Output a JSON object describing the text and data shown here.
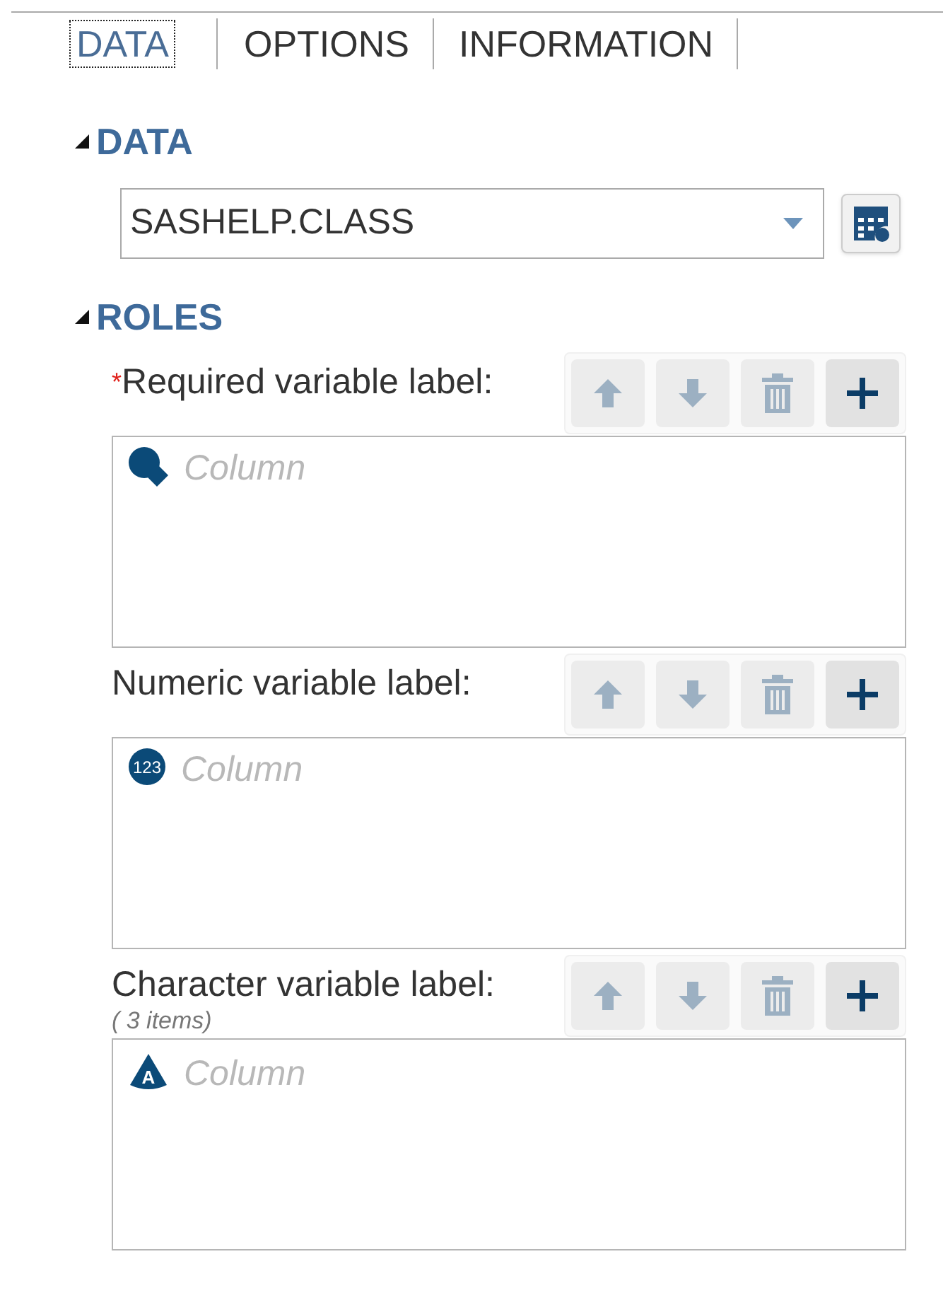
{
  "tabs": [
    {
      "label": "DATA",
      "selected": true
    },
    {
      "label": "OPTIONS",
      "selected": false
    },
    {
      "label": "INFORMATION",
      "selected": false
    }
  ],
  "data_section": {
    "title": "DATA",
    "expanded": true,
    "dataset": "SASHELP.CLASS"
  },
  "roles_section": {
    "title": "ROLES",
    "expanded": true,
    "roles": [
      {
        "label": "Required variable label:",
        "required": true,
        "required_mark": "*",
        "kind": "any",
        "placeholder": "Column",
        "buttons": [
          {
            "kind": "up",
            "disabled": true
          },
          {
            "kind": "down",
            "disabled": true
          },
          {
            "kind": "delete",
            "disabled": true
          },
          {
            "kind": "add",
            "disabled": false
          }
        ]
      },
      {
        "label": "Numeric variable label:",
        "required": false,
        "kind": "numeric",
        "icon_label": "123",
        "placeholder": "Column",
        "buttons": [
          {
            "kind": "up",
            "disabled": true
          },
          {
            "kind": "down",
            "disabled": true
          },
          {
            "kind": "delete",
            "disabled": true
          },
          {
            "kind": "add",
            "disabled": false
          }
        ]
      },
      {
        "label": "Character variable label:",
        "required": false,
        "kind": "character",
        "icon_label": "A",
        "note": "( 3 items)",
        "placeholder": "Column",
        "buttons": [
          {
            "kind": "up",
            "disabled": true
          },
          {
            "kind": "down",
            "disabled": true
          },
          {
            "kind": "delete",
            "disabled": true
          },
          {
            "kind": "add",
            "disabled": false
          }
        ]
      }
    ]
  }
}
